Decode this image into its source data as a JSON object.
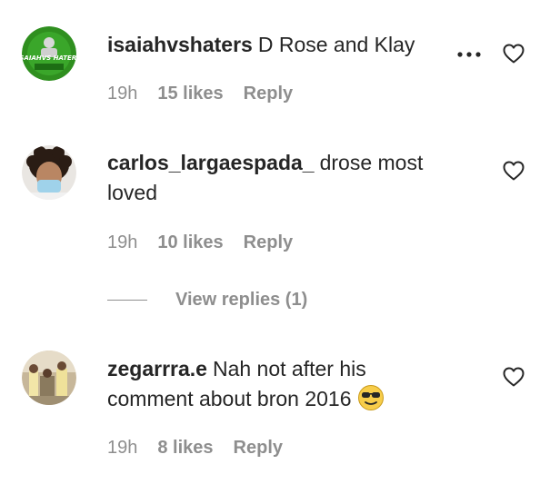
{
  "comments": [
    {
      "username": "isaiahvshaters",
      "text": "D Rose and Klay",
      "time": "19h",
      "likes": "15 likes",
      "reply": "Reply",
      "avatar_text": "ISAIAHVS HATERS",
      "avatar_bg": "#2f8f1f"
    },
    {
      "username": "carlos_largaespada_",
      "text": "drose most loved",
      "time": "19h",
      "likes": "10 likes",
      "reply": "Reply",
      "avatar_bg": "#e9e6e2"
    },
    {
      "username": "zegarrra.e",
      "text": "Nah not after his comment about bron 2016",
      "time": "19h",
      "likes": "8 likes",
      "reply": "Reply",
      "avatar_bg": "#c7b79a"
    }
  ],
  "view_replies": {
    "label": "View replies (1)"
  },
  "icons": {
    "heart": "heart-icon",
    "more": "more-options-icon",
    "emoji": "sunglasses-emoji-icon"
  },
  "colors": {
    "text": "#262626",
    "secondary": "#8e8e8e"
  }
}
